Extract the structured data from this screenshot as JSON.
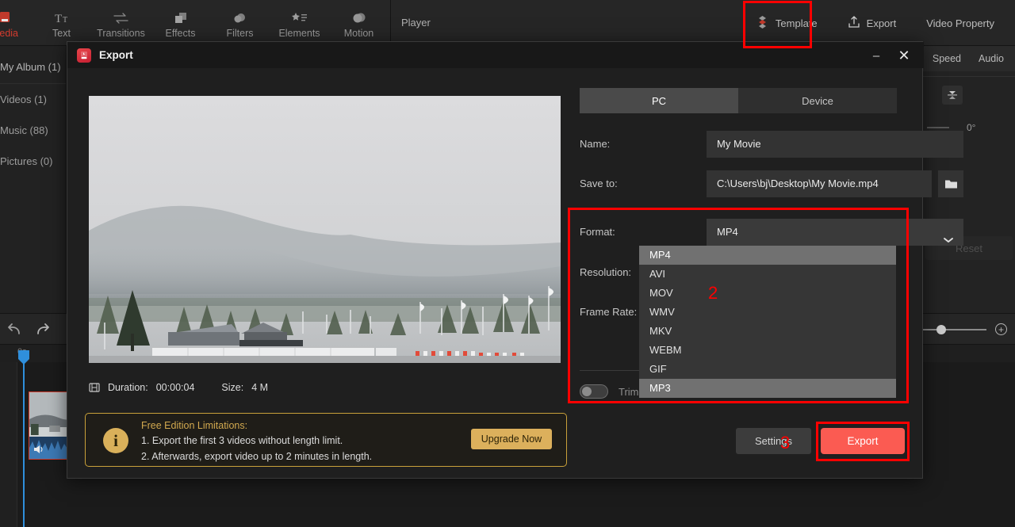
{
  "toolbar": {
    "tabs": [
      {
        "label": "Media",
        "icon": "media-icon",
        "active": true
      },
      {
        "label": "Text",
        "icon": "text-icon",
        "active": false
      },
      {
        "label": "Transitions",
        "icon": "transitions-icon",
        "active": false
      },
      {
        "label": "Effects",
        "icon": "effects-icon",
        "active": false
      },
      {
        "label": "Filters",
        "icon": "filters-icon",
        "active": false
      },
      {
        "label": "Elements",
        "icon": "elements-icon",
        "active": false
      },
      {
        "label": "Motion",
        "icon": "motion-icon",
        "active": false
      }
    ],
    "player_label": "Player",
    "template_label": "Template",
    "export_label": "Export",
    "video_property_label": "Video Property"
  },
  "media_panel": {
    "items": [
      {
        "label": "My Album (1)"
      },
      {
        "label": "Videos (1)"
      },
      {
        "label": "Music (88)"
      },
      {
        "label": "Pictures (0)"
      }
    ]
  },
  "property_panel": {
    "tabs": [
      "Speed",
      "Audio"
    ],
    "rotation_value": "0°",
    "reset_label": "Reset"
  },
  "timeline": {
    "time_label": "0s"
  },
  "dialog": {
    "title": "Export",
    "minimize_label": "–",
    "close_label": "✕",
    "duration_label": "Duration:",
    "duration_value": "00:00:04",
    "size_label": "Size:",
    "size_value": "4 M",
    "target_tabs": [
      {
        "label": "PC",
        "active": true
      },
      {
        "label": "Device",
        "active": false
      }
    ],
    "name_label": "Name:",
    "name_value": "My Movie",
    "save_to_label": "Save to:",
    "save_to_value": "C:\\Users\\bj\\Desktop\\My Movie.mp4",
    "format_label": "Format:",
    "format_value": "MP4",
    "resolution_label": "Resolution:",
    "frame_rate_label": "Frame Rate:",
    "trim_label": "Trim",
    "format_options": [
      {
        "label": "MP4",
        "selected": true
      },
      {
        "label": "AVI",
        "selected": false
      },
      {
        "label": "MOV",
        "selected": false
      },
      {
        "label": "WMV",
        "selected": false
      },
      {
        "label": "MKV",
        "selected": false
      },
      {
        "label": "WEBM",
        "selected": false
      },
      {
        "label": "GIF",
        "selected": false
      },
      {
        "label": "MP3",
        "selected": true
      }
    ],
    "limitations": {
      "heading": "Free Edition Limitations:",
      "line1": "1. Export the first 3 videos without length limit.",
      "line2": "2. Afterwards, export video up to 2 minutes in length.",
      "upgrade_label": "Upgrade Now",
      "info_glyph": "i"
    },
    "settings_label": "Settings",
    "export_label": "Export"
  },
  "annotations": {
    "step2": "2",
    "step3": "3",
    "highlight_color": "#ff0000"
  }
}
